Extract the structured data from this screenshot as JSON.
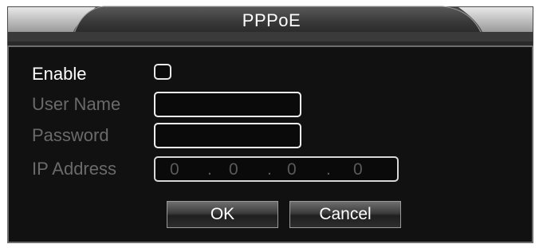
{
  "dialog": {
    "title": "PPPoE",
    "enable_label": "Enable",
    "enable_checked": false,
    "user_name_label": "User Name",
    "user_name_value": "",
    "password_label": "Password",
    "password_value": "",
    "ip_address_label": "IP Address",
    "ip_address": [
      "0",
      "0",
      "0",
      "0"
    ],
    "ok_label": "OK",
    "cancel_label": "Cancel"
  },
  "colors": {
    "panel_background": "#111111",
    "enabled_text": "#ffffff",
    "disabled_text": "#6a6a6a"
  }
}
